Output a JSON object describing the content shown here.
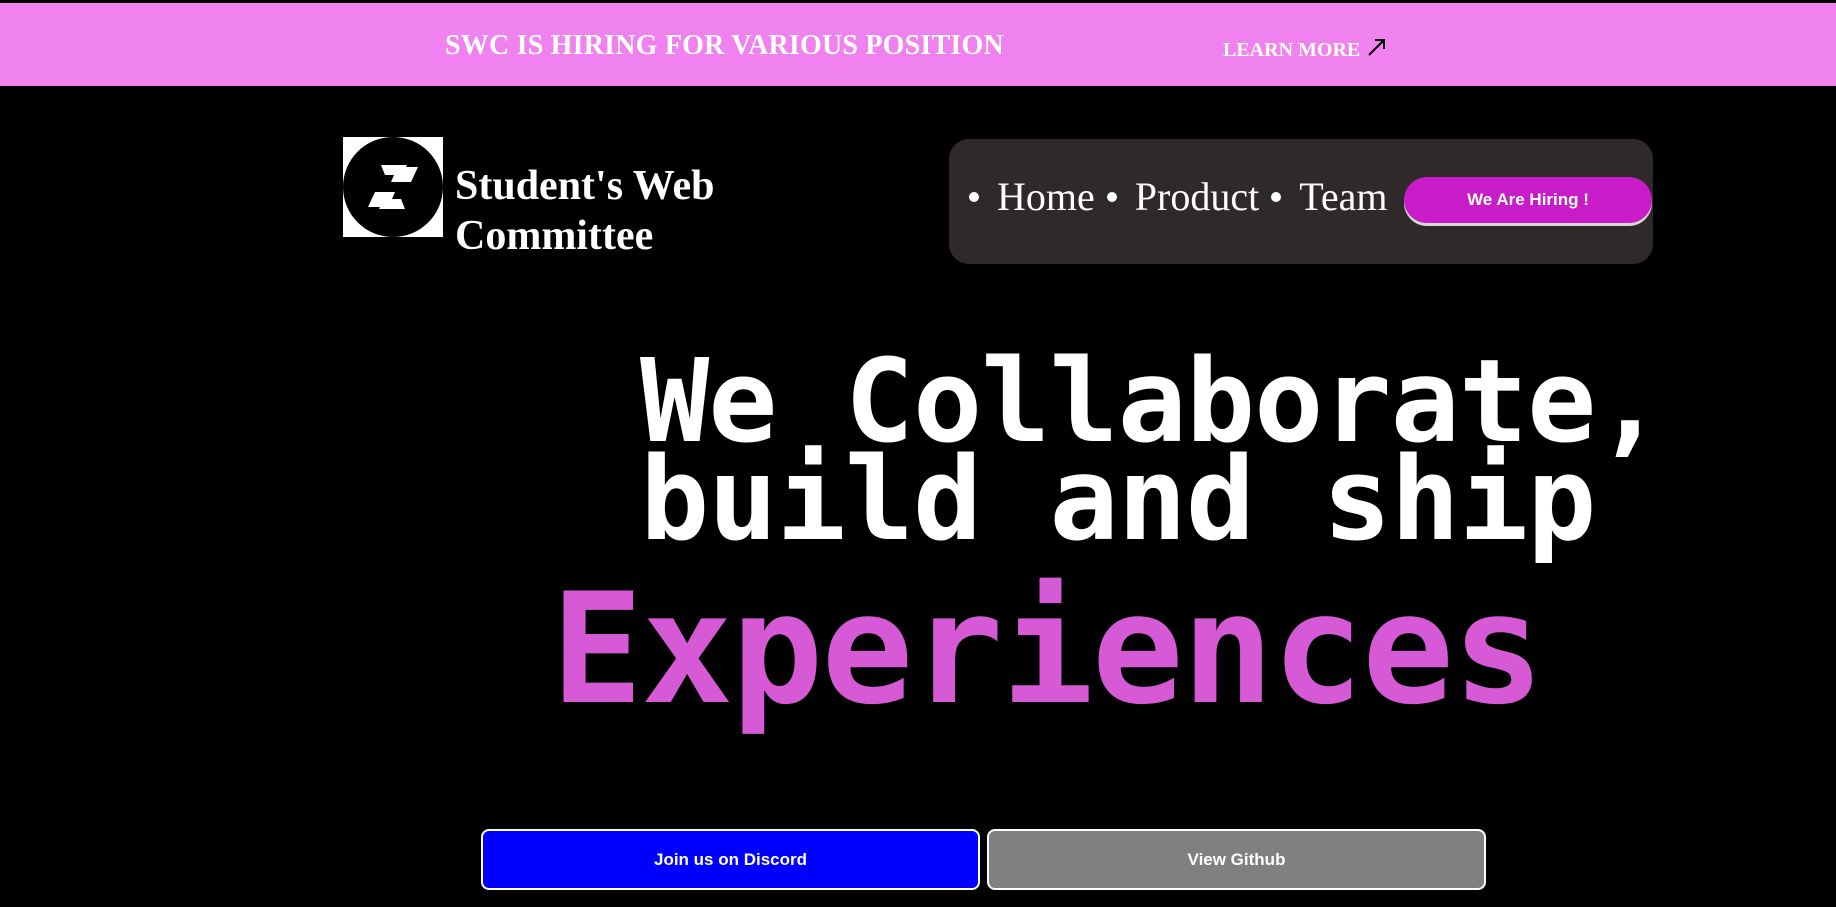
{
  "banner": {
    "title": "SWC IS HIRING FOR VARIOUS POSITION",
    "link_label": "LEARN MORE",
    "link_icon": "arrow-up-right-icon",
    "background": "#ef82ef"
  },
  "brand": {
    "logo_icon": "swc-logo-icon",
    "name_line1": "Student's Web",
    "name_line2": "Committee"
  },
  "nav": {
    "items": [
      {
        "label": "Home"
      },
      {
        "label": "Product"
      },
      {
        "label": "Team"
      }
    ],
    "cta_label": "We Are Hiring !",
    "cta_color": "#c71cc7"
  },
  "hero": {
    "line1": "We Collaborate,",
    "line2": "build and ship",
    "accent": "Experiences",
    "accent_color": "#d65ad6"
  },
  "actions": {
    "discord_label": "Join us on Discord",
    "discord_color": "#0000ff",
    "github_label": "View Github",
    "github_color": "#808080"
  }
}
